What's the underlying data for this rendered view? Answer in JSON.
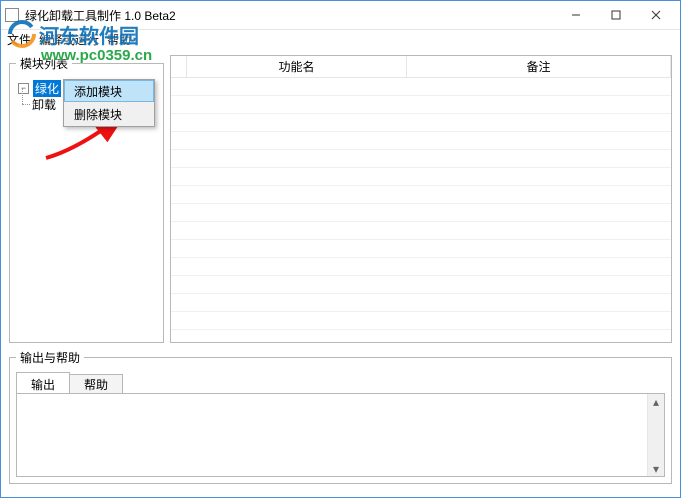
{
  "window": {
    "title": "绿化卸载工具制作 1.0 Beta2"
  },
  "menubar": {
    "items": [
      "文件",
      "编译或运行",
      "帮助"
    ]
  },
  "moduleList": {
    "legend": "模块列表",
    "root": "绿化",
    "children": [
      "卸载"
    ]
  },
  "contextMenu": {
    "items": [
      {
        "label": "添加模块",
        "selected": true
      },
      {
        "label": "删除模块",
        "selected": false
      }
    ]
  },
  "funcPanel": {
    "cols": {
      "c1": "",
      "c2": "功能名",
      "c3": "备注"
    }
  },
  "outputPanel": {
    "legend": "输出与帮助",
    "tabs": [
      {
        "label": "输出",
        "active": true
      },
      {
        "label": "帮助",
        "active": false
      }
    ]
  },
  "watermark": {
    "brand": "河东软件园",
    "url": "www.pc0359.cn"
  },
  "colors": {
    "accent": "#0078d7",
    "border": "#b8b8b8",
    "green": "#2aa84a",
    "blue": "#0a6fb8",
    "orange": "#f7941d"
  }
}
